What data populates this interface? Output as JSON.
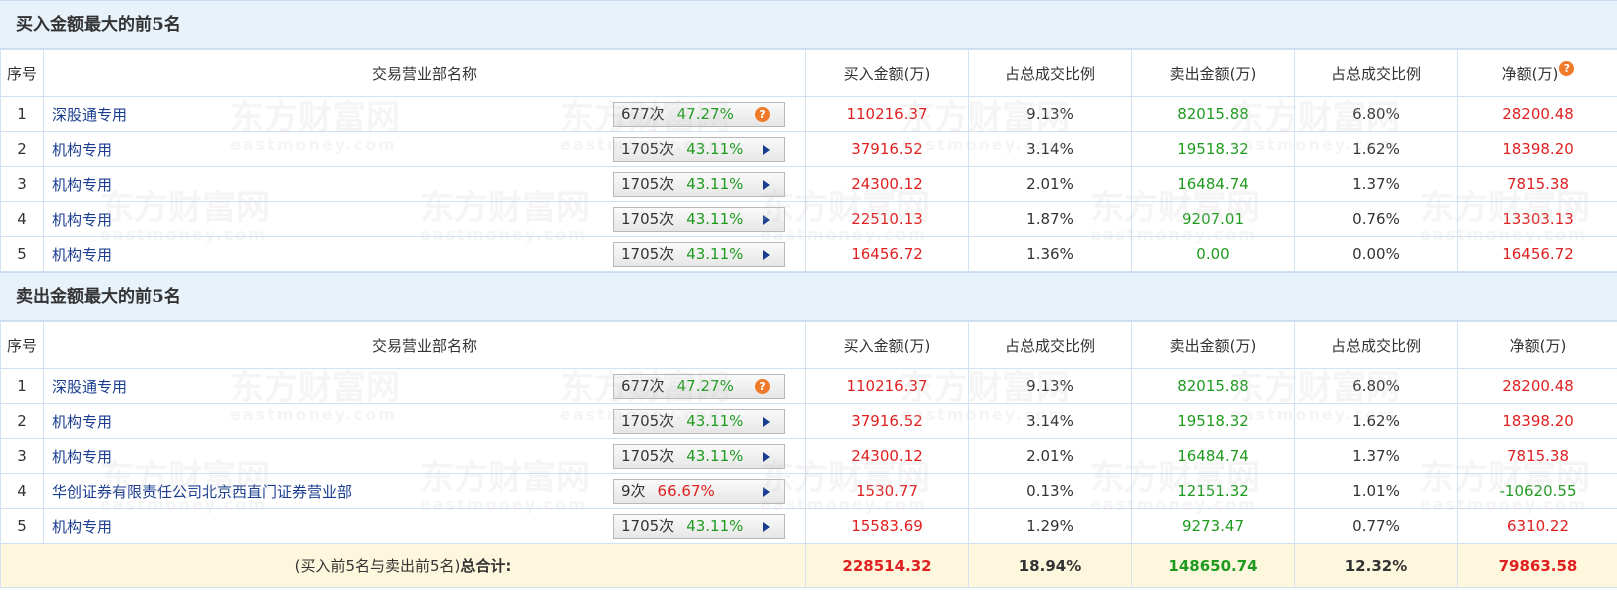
{
  "watermark": {
    "brand": "东方财富网",
    "domain": "eastmoney.com"
  },
  "buy_section": {
    "title": "买入金额最大的前5名",
    "headers": {
      "index": "序号",
      "name": "交易营业部名称",
      "buy": "买入金额(万)",
      "buy_ratio": "占总成交比例",
      "sell": "卖出金额(万)",
      "sell_ratio": "占总成交比例",
      "net": "净额(万)",
      "net_help": "?"
    },
    "rows": [
      {
        "idx": "1",
        "name": "深股通专用",
        "count": "677次",
        "pct": "47.27%",
        "buy": "110216.37",
        "buy_ratio": "9.13%",
        "sell": "82015.88",
        "sell_ratio": "6.80%",
        "net": "28200.48",
        "action": "?"
      },
      {
        "idx": "2",
        "name": "机构专用",
        "count": "1705次",
        "pct": "43.11%",
        "buy": "37916.52",
        "buy_ratio": "3.14%",
        "sell": "19518.32",
        "sell_ratio": "1.62%",
        "net": "18398.20"
      },
      {
        "idx": "3",
        "name": "机构专用",
        "count": "1705次",
        "pct": "43.11%",
        "buy": "24300.12",
        "buy_ratio": "2.01%",
        "sell": "16484.74",
        "sell_ratio": "1.37%",
        "net": "7815.38"
      },
      {
        "idx": "4",
        "name": "机构专用",
        "count": "1705次",
        "pct": "43.11%",
        "buy": "22510.13",
        "buy_ratio": "1.87%",
        "sell": "9207.01",
        "sell_ratio": "0.76%",
        "net": "13303.13"
      },
      {
        "idx": "5",
        "name": "机构专用",
        "count": "1705次",
        "pct": "43.11%",
        "buy": "16456.72",
        "buy_ratio": "1.36%",
        "sell": "0.00",
        "sell_ratio": "0.00%",
        "net": "16456.72"
      }
    ]
  },
  "sell_section": {
    "title": "卖出金额最大的前5名",
    "headers": {
      "index": "序号",
      "name": "交易营业部名称",
      "buy": "买入金额(万)",
      "buy_ratio": "占总成交比例",
      "sell": "卖出金额(万)",
      "sell_ratio": "占总成交比例",
      "net": "净额(万)"
    },
    "rows": [
      {
        "idx": "1",
        "name": "深股通专用",
        "count": "677次",
        "pct": "47.27%",
        "buy": "110216.37",
        "buy_ratio": "9.13%",
        "sell": "82015.88",
        "sell_ratio": "6.80%",
        "net": "28200.48",
        "action": "?"
      },
      {
        "idx": "2",
        "name": "机构专用",
        "count": "1705次",
        "pct": "43.11%",
        "buy": "37916.52",
        "buy_ratio": "3.14%",
        "sell": "19518.32",
        "sell_ratio": "1.62%",
        "net": "18398.20"
      },
      {
        "idx": "3",
        "name": "机构专用",
        "count": "1705次",
        "pct": "43.11%",
        "buy": "24300.12",
        "buy_ratio": "2.01%",
        "sell": "16484.74",
        "sell_ratio": "1.37%",
        "net": "7815.38"
      },
      {
        "idx": "4",
        "name": "华创证券有限责任公司北京西直门证券营业部",
        "count": "9次",
        "pct": "66.67%",
        "pct_color": "red",
        "buy": "1530.77",
        "buy_ratio": "0.13%",
        "sell": "12151.32",
        "sell_ratio": "1.01%",
        "net": "-10620.55",
        "net_color": "green"
      },
      {
        "idx": "5",
        "name": "机构专用",
        "count": "1705次",
        "pct": "43.11%",
        "buy": "15583.69",
        "buy_ratio": "1.29%",
        "sell": "9273.47",
        "sell_ratio": "0.77%",
        "net": "6310.22"
      }
    ]
  },
  "total": {
    "label_prefix": "(买入前5名与卖出前5名)",
    "label_bold": "总合计:",
    "buy": "228514.32",
    "buy_ratio": "18.94%",
    "sell": "148650.74",
    "sell_ratio": "12.32%",
    "net": "79863.58"
  },
  "colors": {
    "buy": "#e02020",
    "sell": "#1e9b1e",
    "section_bg": "#e8f2fb",
    "total_bg": "#fdf7dd",
    "name_link": "#1a3d8f"
  }
}
